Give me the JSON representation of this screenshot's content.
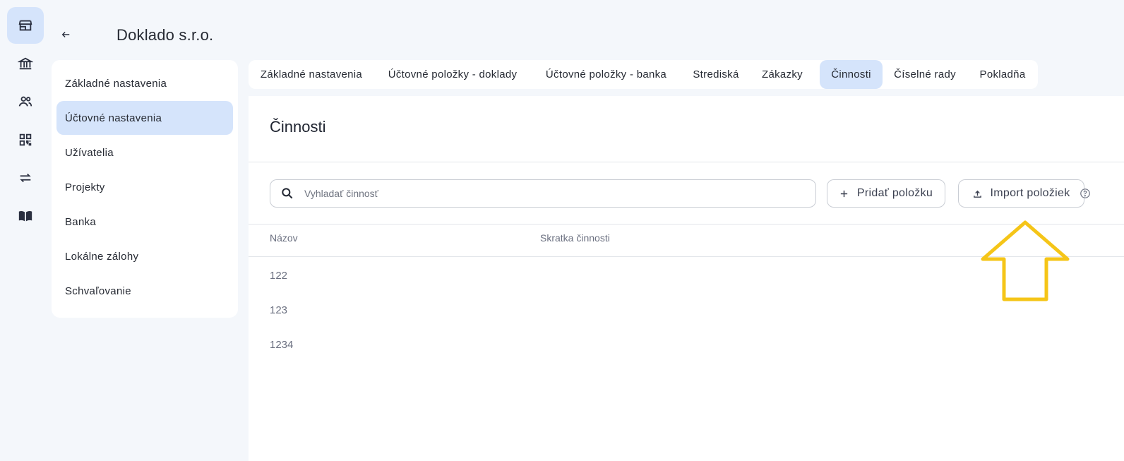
{
  "rail": {
    "items": [
      {
        "icon": "store-icon",
        "active": true
      },
      {
        "icon": "bank-icon",
        "active": false
      },
      {
        "icon": "users-icon",
        "active": false
      },
      {
        "icon": "qr-code-icon",
        "active": false
      },
      {
        "icon": "transfer-icon",
        "active": false
      },
      {
        "icon": "book-icon",
        "active": false
      }
    ]
  },
  "header": {
    "company": "Doklado s.r.o."
  },
  "settings_nav": {
    "items": [
      {
        "label": "Základné nastavenia"
      },
      {
        "label": "Účtovné nastavenia",
        "active": true
      },
      {
        "label": "Užívatelia"
      },
      {
        "label": "Projekty"
      },
      {
        "label": "Banka"
      },
      {
        "label": "Lokálne zálohy"
      },
      {
        "label": "Schvaľovanie"
      }
    ]
  },
  "tabs": [
    {
      "label": "Základné nastavenia"
    },
    {
      "label": "Účtovné položky - doklady"
    },
    {
      "label": "Účtovné položky - banka"
    },
    {
      "label": "Strediská"
    },
    {
      "label": "Zákazky"
    },
    {
      "label": "Činnosti",
      "active": true
    },
    {
      "label": "Číselné rady"
    },
    {
      "label": "Pokladňa"
    }
  ],
  "main": {
    "title": "Činnosti",
    "search_placeholder": "Vyhladať činnosť",
    "add_label": "Pridať položku",
    "import_label": "Import položiek",
    "columns": [
      "Názov",
      "Skratka činnosti"
    ],
    "rows": [
      {
        "name": "122",
        "abbr": ""
      },
      {
        "name": "123",
        "abbr": ""
      },
      {
        "name": "1234",
        "abbr": ""
      }
    ]
  },
  "colors": {
    "accent_bg": "#d5e4fb",
    "annotation": "#f5c518",
    "page_bg": "#f4f7fb"
  }
}
